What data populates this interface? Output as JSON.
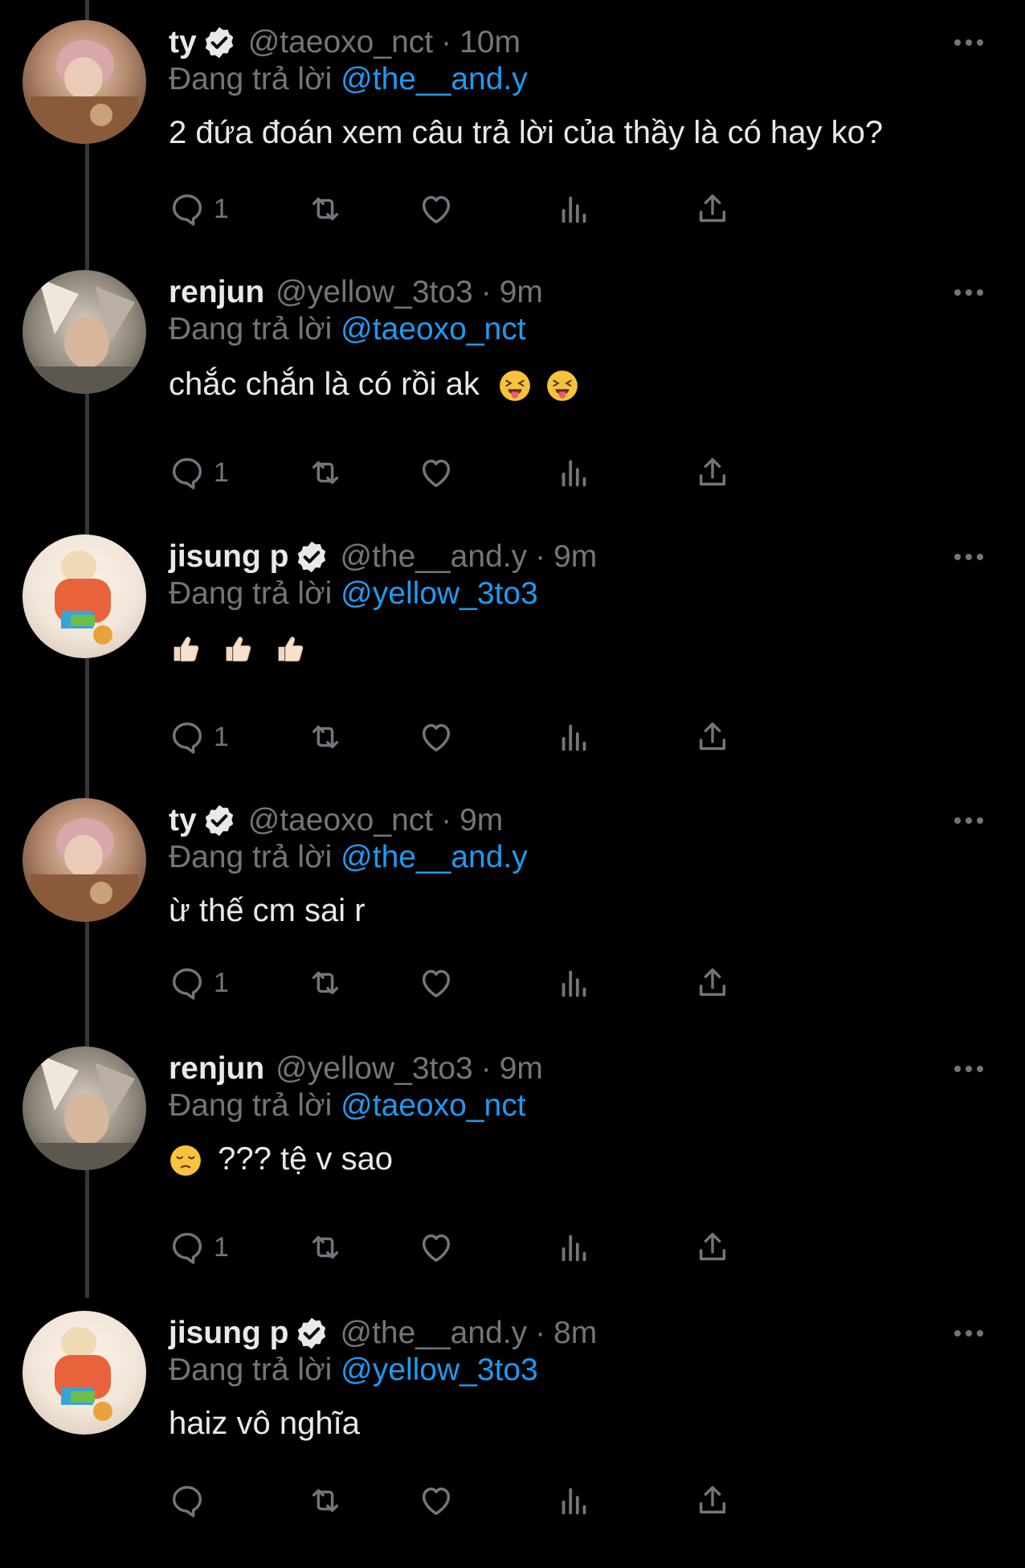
{
  "colors": {
    "background": "#000000",
    "text": "#e7e9ea",
    "muted": "#71767b",
    "accent": "#1d9bf0",
    "line": "#333639"
  },
  "icons": [
    "reply-icon",
    "retweet-icon",
    "like-icon",
    "analytics-icon",
    "share-icon",
    "verified-badge-icon",
    "more-icon"
  ],
  "tweets": [
    {
      "name": "ty",
      "verified": true,
      "handle": "@taeoxo_nct",
      "dot": "·",
      "time": "10m",
      "replying_prefix": "Đang trả lời ",
      "replying_to": "@the__and.y",
      "text": "2 đứa đoán xem câu trả lời của thầy là có hay ko?",
      "reply_count": "1"
    },
    {
      "name": "renjun",
      "verified": false,
      "handle": "@yellow_3to3",
      "dot": "·",
      "time": "9m",
      "replying_prefix": "Đang trả lời ",
      "replying_to": "@taeoxo_nct",
      "text": "chắc chắn là có rồi ak",
      "reply_count": "1"
    },
    {
      "name": "jisung p",
      "verified": true,
      "handle": "@the__and.y",
      "dot": "·",
      "time": "9m",
      "replying_prefix": "Đang trả lời ",
      "replying_to": "@yellow_3to3",
      "text": "",
      "reply_count": "1"
    },
    {
      "name": "ty",
      "verified": true,
      "handle": "@taeoxo_nct",
      "dot": "·",
      "time": "9m",
      "replying_prefix": "Đang trả lời ",
      "replying_to": "@the__and.y",
      "text": "ừ thế cm sai r",
      "reply_count": "1"
    },
    {
      "name": "renjun",
      "verified": false,
      "handle": "@yellow_3to3",
      "dot": "·",
      "time": "9m",
      "replying_prefix": "Đang trả lời ",
      "replying_to": "@taeoxo_nct",
      "text": "??? tệ v sao",
      "reply_count": "1"
    },
    {
      "name": "jisung p",
      "verified": true,
      "handle": "@the__and.y",
      "dot": "·",
      "time": "8m",
      "replying_prefix": "Đang trả lời ",
      "replying_to": "@yellow_3to3",
      "text": "haiz vô nghĩa",
      "reply_count": ""
    }
  ]
}
